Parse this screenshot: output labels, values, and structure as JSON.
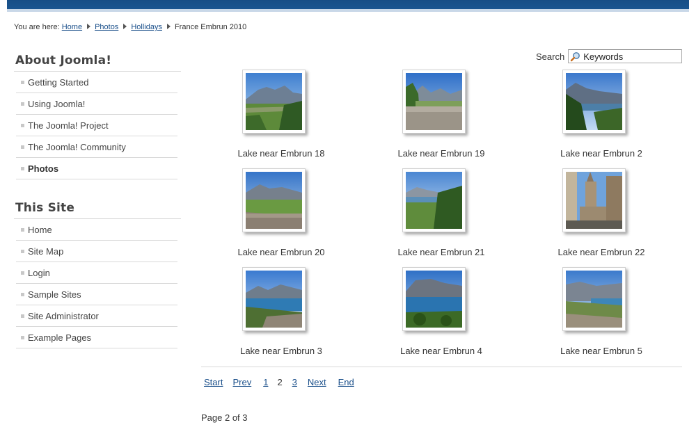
{
  "breadcrumb": {
    "prefix": "You are here:",
    "items": [
      "Home",
      "Photos",
      "Hollidays"
    ],
    "current": "France Embrun 2010"
  },
  "sidebar": {
    "about": {
      "title": "About Joomla!",
      "items": [
        "Getting Started",
        "Using Joomla!",
        "The Joomla! Project",
        "The Joomla! Community",
        "Photos"
      ]
    },
    "site": {
      "title": "This Site",
      "items": [
        "Home",
        "Site Map",
        "Login",
        "Sample Sites",
        "Site Administrator",
        "Example Pages"
      ]
    }
  },
  "search": {
    "label": "Search",
    "value": "Keywords"
  },
  "gallery": {
    "photos": [
      "Lake near Embrun 18",
      "Lake near Embrun 19",
      "Lake near Embrun 2",
      "Lake near Embrun 20",
      "Lake near Embrun 21",
      "Lake near Embrun 22",
      "Lake near Embrun 3",
      "Lake near Embrun 4",
      "Lake near Embrun 5"
    ]
  },
  "pagination": {
    "start": "Start",
    "prev": "Prev",
    "pages": [
      "1",
      "2",
      "3"
    ],
    "current": "2",
    "next": "Next",
    "end": "End",
    "status": "Page 2 of 3"
  },
  "colors": {
    "header": "#174e86",
    "link": "#1a4f8a"
  }
}
